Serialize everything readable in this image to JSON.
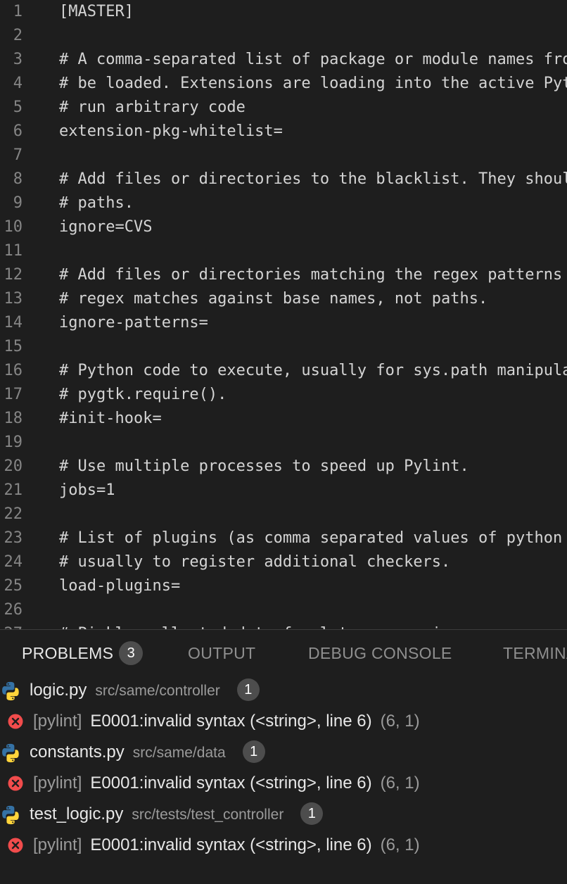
{
  "editor": {
    "lines": [
      {
        "number": "1",
        "text": "[MASTER]"
      },
      {
        "number": "2",
        "text": ""
      },
      {
        "number": "3",
        "text": "# A comma-separated list of package or module names fro"
      },
      {
        "number": "4",
        "text": "# be loaded. Extensions are loading into the active Pyt"
      },
      {
        "number": "5",
        "text": "# run arbitrary code"
      },
      {
        "number": "6",
        "text": "extension-pkg-whitelist="
      },
      {
        "number": "7",
        "text": ""
      },
      {
        "number": "8",
        "text": "# Add files or directories to the blacklist. They shoul"
      },
      {
        "number": "9",
        "text": "# paths."
      },
      {
        "number": "10",
        "text": "ignore=CVS"
      },
      {
        "number": "11",
        "text": ""
      },
      {
        "number": "12",
        "text": "# Add files or directories matching the regex patterns"
      },
      {
        "number": "13",
        "text": "# regex matches against base names, not paths."
      },
      {
        "number": "14",
        "text": "ignore-patterns="
      },
      {
        "number": "15",
        "text": ""
      },
      {
        "number": "16",
        "text": "# Python code to execute, usually for sys.path manipula"
      },
      {
        "number": "17",
        "text": "# pygtk.require()."
      },
      {
        "number": "18",
        "text": "#init-hook="
      },
      {
        "number": "19",
        "text": ""
      },
      {
        "number": "20",
        "text": "# Use multiple processes to speed up Pylint."
      },
      {
        "number": "21",
        "text": "jobs=1"
      },
      {
        "number": "22",
        "text": ""
      },
      {
        "number": "23",
        "text": "# List of plugins (as comma separated values of python"
      },
      {
        "number": "24",
        "text": "# usually to register additional checkers."
      },
      {
        "number": "25",
        "text": "load-plugins="
      },
      {
        "number": "26",
        "text": ""
      },
      {
        "number": "27",
        "text": "# Pickle collected data for later comparisons."
      }
    ]
  },
  "panel": {
    "tabs": [
      {
        "label": "PROBLEMS",
        "badge": "3",
        "active": true
      },
      {
        "label": "OUTPUT"
      },
      {
        "label": "DEBUG CONSOLE"
      },
      {
        "label": "TERMINAL"
      }
    ],
    "files": [
      {
        "name": "logic.py",
        "path": "src/same/controller",
        "count": "1",
        "problem": {
          "source": "[pylint]",
          "message": "E0001:invalid syntax (<string>, line 6)",
          "location": "(6, 1)"
        }
      },
      {
        "name": "constants.py",
        "path": "src/same/data",
        "count": "1",
        "problem": {
          "source": "[pylint]",
          "message": "E0001:invalid syntax (<string>, line 6)",
          "location": "(6, 1)"
        }
      },
      {
        "name": "test_logic.py",
        "path": "src/tests/test_controller",
        "count": "1",
        "problem": {
          "source": "[pylint]",
          "message": "E0001:invalid syntax (<string>, line 6)",
          "location": "(6, 1)"
        }
      }
    ]
  },
  "colors": {
    "background": "#1e1e1e",
    "text": "#d4d4d4",
    "line_number": "#858585",
    "badge": "#4d4d4d",
    "error": "#f14c4c",
    "python_blue": "#3572a5",
    "python_yellow": "#ffd43b"
  }
}
